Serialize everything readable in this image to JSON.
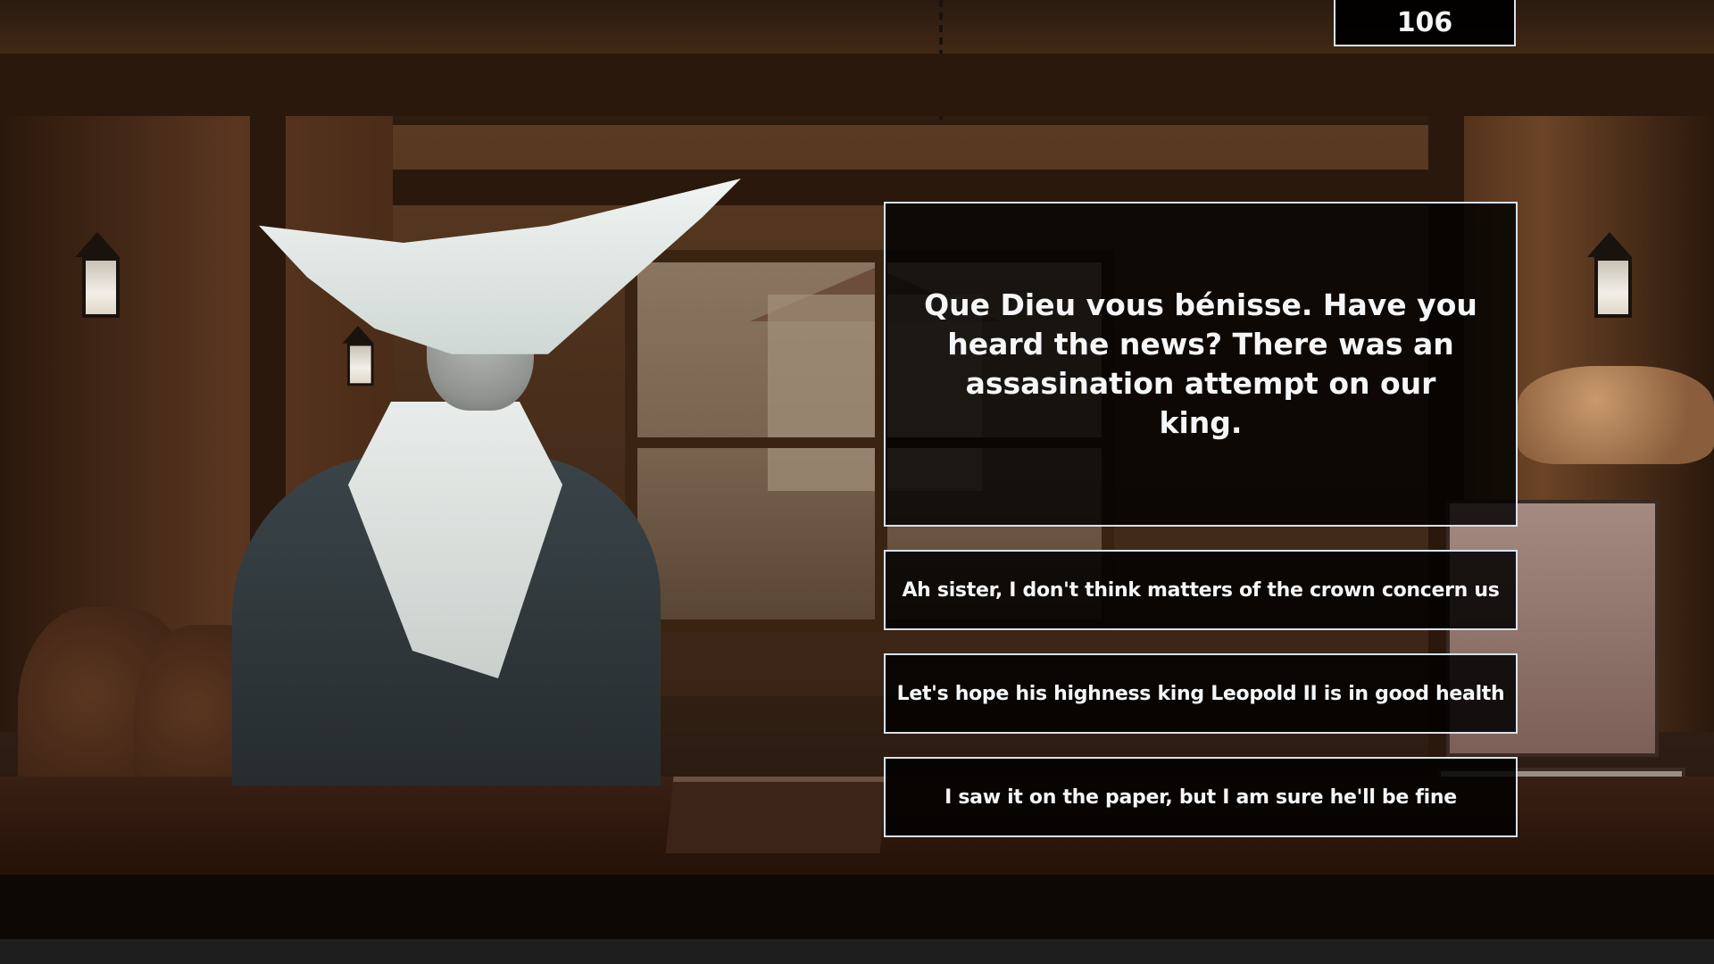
{
  "hud": {
    "score": "106"
  },
  "dialogue": {
    "text": "Que Dieu vous bénisse. Have you heard the news? There was an assasination attempt on our king."
  },
  "choices": [
    {
      "label": "Ah sister, I don't think matters of the crown concern us"
    },
    {
      "label": "Let's hope his highness king Leopold II is in good health"
    },
    {
      "label": "I saw it on the paper, but I am sure he'll be fine"
    }
  ],
  "colors": {
    "panel_border": "#d8e2ea",
    "panel_bg": "#000000",
    "text": "#f4f6f8"
  }
}
